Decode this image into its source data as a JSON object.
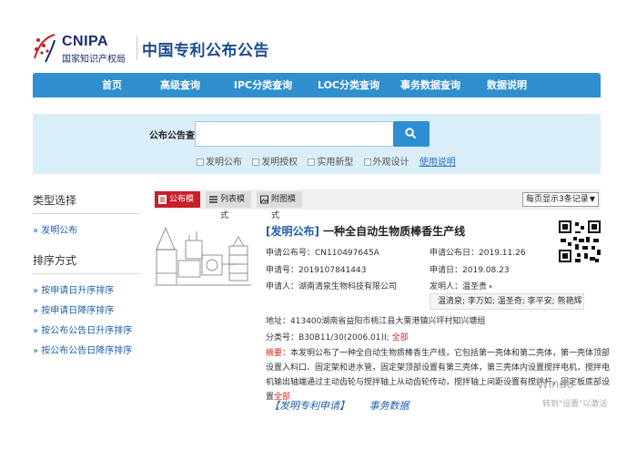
{
  "header": {
    "logo_en": "CNIPA",
    "logo_cn": "国家知识产权局",
    "site_title": "中国专利公布公告"
  },
  "nav": {
    "items": [
      "首页",
      "高级查询",
      "IPC分类查询",
      "LOC分类查询",
      "事务数据查询",
      "数据说明"
    ]
  },
  "search": {
    "label": "公布公告查询",
    "value": "",
    "filters": [
      "发明公布",
      "发明授权",
      "实用新型",
      "外观设计"
    ],
    "help": "使用说明"
  },
  "sidebar": {
    "type_heading": "类型选择",
    "type_items": [
      "» 发明公布"
    ],
    "sort_heading": "排序方式",
    "sort_items": [
      "» 按申请日升序排序",
      "» 按申请日降序排序",
      "» 按公布公告日升序排序",
      "» 按公布公告日降序排序"
    ]
  },
  "toolbar": {
    "views": [
      "公布模式",
      "列表模式",
      "附图模式"
    ],
    "per_page": "每页显示3条记录"
  },
  "result": {
    "tag": "[发明公布]",
    "title": " 一种全自动生物质棒香生产线",
    "pub_no_label": "申请公布号：",
    "pub_no": "CN110497645A",
    "pub_date_label": "申请公布日：",
    "pub_date": "2019.11.26",
    "app_no_label": "申请号：",
    "app_no": "2019107841443",
    "app_date_label": "申请日：",
    "app_date": "2019.08.23",
    "applicant_label": "申请人：",
    "applicant": "湖南清泉生物科技有限公司",
    "inventor_label": "发明人：",
    "inventor": "温圣贵",
    "inventors_more": "温清泉; 李万如; 温圣奇; 李平安; 熊艳辉",
    "address_label": "地址：",
    "address": "413400湖南省益阳市桃江县大栗港镇兴坪村知兴塘组",
    "class_label": "分类号：",
    "class_no": "B30B11/30(2006.01)I;",
    "class_all": "全部",
    "abstract_label": "摘要：",
    "abstract": "本发明公布了一种全自动生物质棒香生产线，它包括第一壳体和第二壳体，第一壳体顶部设置入料口、固定架和进水管，固定架顶部设置有第三壳体，第三壳体内设置搅拌电机，搅拌电机输出轴端通过主动齿轮与搅拌轴上从动齿轮传动，搅拌轴上间距设置有搅拌杆，固定板底部设置",
    "abstract_more": "全部",
    "link_detail": "【发明专利申请】",
    "link_affairs": "事务数据"
  },
  "watermark": {
    "line1": "Windo",
    "line2": "转到\"设置\"以激活"
  },
  "colors": {
    "nav_blue": "#2f8fcf",
    "active_red": "#c8202a",
    "link_blue": "#1f5fa8",
    "search_bg": "#d9eef9"
  }
}
